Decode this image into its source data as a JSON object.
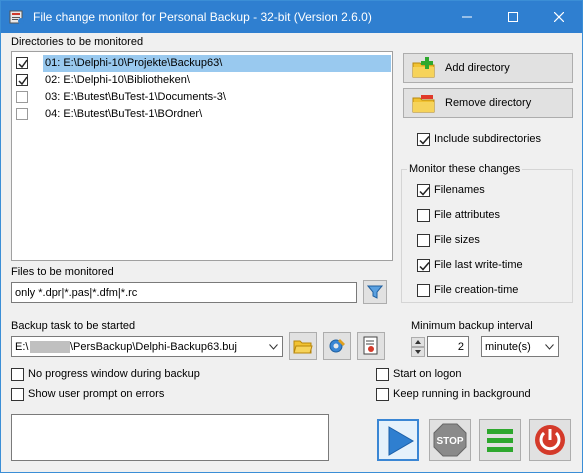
{
  "titlebar": {
    "title": "File change monitor for Personal Backup - 32-bit (Version 2.6.0)",
    "icons": [
      "app-icon",
      "minimize-icon",
      "maximize-icon",
      "close-icon"
    ]
  },
  "directories": {
    "label": "Directories to be monitored",
    "items": [
      {
        "text": "01: E:\\Delphi-10\\Projekte\\Backup63\\",
        "checked": true,
        "selected": true
      },
      {
        "text": "02: E:\\Delphi-10\\Bibliotheken\\",
        "checked": true,
        "selected": false
      },
      {
        "text": "03: E:\\Butest\\BuTest-1\\Documents-3\\",
        "checked": false,
        "selected": false
      },
      {
        "text": "04: E:\\Butest\\BuTest-1\\BOrdner\\",
        "checked": false,
        "selected": false
      }
    ]
  },
  "buttons": {
    "add_directory": "Add directory",
    "remove_directory": "Remove directory"
  },
  "options": {
    "include_subdirectories": {
      "label": "Include subdirectories",
      "checked": true
    }
  },
  "monitor_changes": {
    "title": "Monitor these changes",
    "items": [
      {
        "label": "Filenames",
        "checked": true
      },
      {
        "label": "File attributes",
        "checked": false
      },
      {
        "label": "File sizes",
        "checked": false
      },
      {
        "label": "File last write-time",
        "checked": true
      },
      {
        "label": "File creation-time",
        "checked": false
      }
    ]
  },
  "files": {
    "label": "Files to be monitored",
    "value": "only *.dpr|*.pas|*.dfm|*.rc"
  },
  "backup_task": {
    "label": "Backup task to be started",
    "value_prefix": "E:\\",
    "value_suffix": "\\PersBackup\\Delphi-Backup63.buj"
  },
  "interval": {
    "label": "Minimum backup interval",
    "value": "2",
    "unit": "minute(s)"
  },
  "bottom_options": {
    "no_progress": {
      "label": "No progress window during backup",
      "checked": false
    },
    "show_prompt": {
      "label": "Show user prompt on errors",
      "checked": false
    },
    "start_on_logon": {
      "label": "Start on logon",
      "checked": false
    },
    "keep_running": {
      "label": "Keep running in background",
      "checked": false
    }
  },
  "action_icons": [
    "play-icon",
    "stop-icon",
    "menu-icon",
    "power-icon"
  ],
  "colors": {
    "titlebar": "#2f7fd0",
    "selection": "#99c9ef",
    "play": "#2f7fd0",
    "stop": "#8a8a8a",
    "menu": "#2ea82e",
    "power": "#d43a2a"
  }
}
